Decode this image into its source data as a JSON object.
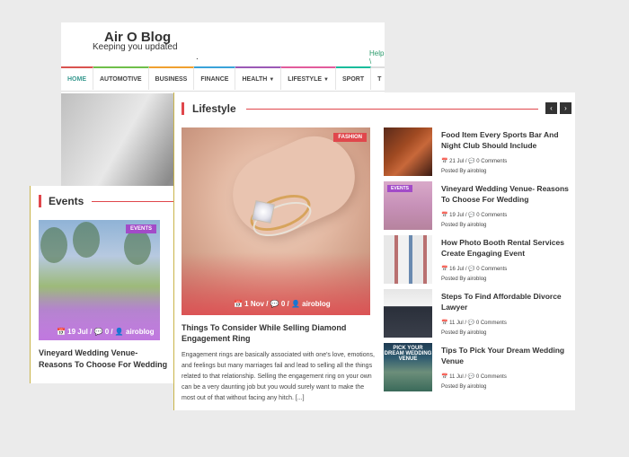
{
  "site": {
    "title": "Air O Blog",
    "tagline": "Keeping you updated",
    "dot": ".",
    "help": "Help \\"
  },
  "nav": [
    "HOME",
    "AUTOMOTIVE",
    "BUSINESS",
    "FINANCE",
    "HEALTH",
    "LIFESTYLE",
    "SPORT",
    "T"
  ],
  "events": {
    "heading": "Events",
    "badge": "EVENTS",
    "meta": "📅 19 Jul / 💬 0 / 👤 airoblog",
    "title": "Vineyard Wedding Venue- Reasons To Choose For Wedding"
  },
  "lifestyle": {
    "heading": "Lifestyle",
    "prev": "‹",
    "next": "›",
    "main": {
      "badge": "FASHION",
      "meta": "📅 1 Nov / 💬 0 / 👤 airoblog",
      "title": "Things To Consider While Selling Diamond Engagement Ring",
      "excerpt": "Engagement rings are basically associated with one's love, emotions, and feelings but many marriages fail and lead to selling all the things related to that relationship. Selling the engagement ring on your own can be a very daunting job but you would surely want to make the most out of that without facing any hitch. [...]"
    },
    "items": [
      {
        "title": "Food Item Every Sports Bar And Night Club Should Include",
        "date": "📅 21 Jul  /  💬 0 Comments",
        "by": "Posted By  airoblog"
      },
      {
        "title": "Vineyard Wedding Venue- Reasons To Choose For Wedding",
        "date": "📅 19 Jul  /  💬 0 Comments",
        "by": "Posted By  airoblog",
        "badge": "EVENTS"
      },
      {
        "title": "How Photo Booth Rental Services Create Engaging Event",
        "date": "📅 16 Jul  /  💬 0 Comments",
        "by": "Posted By  airoblog"
      },
      {
        "title": "Steps To Find Affordable Divorce Lawyer",
        "date": "📅 11 Jul  /  💬 0 Comments",
        "by": "Posted By  airoblog"
      },
      {
        "title": "Tips To Pick Your Dream Wedding Venue",
        "date": "📅 11 Jul  /  💬 0 Comments",
        "by": "Posted By  airoblog",
        "thumb_text": "PICK YOUR DREAM WEDDING VENUE"
      }
    ]
  },
  "colors": {
    "accent": "#e0474c",
    "events_badge": "#a24bc8",
    "nav_home": "#3a9a90"
  }
}
